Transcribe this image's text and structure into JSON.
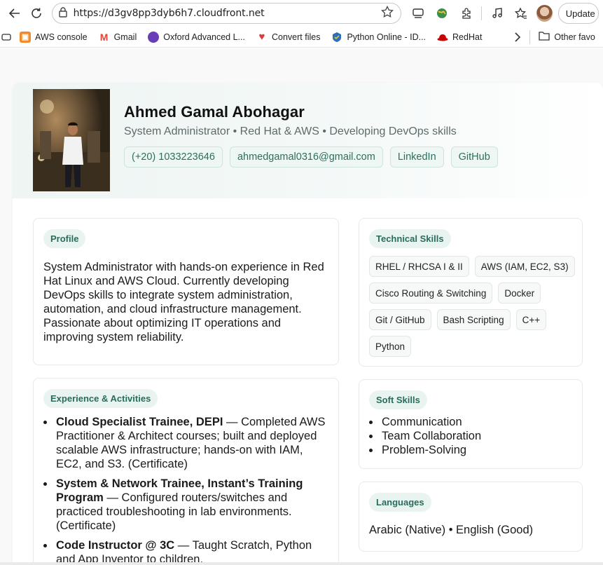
{
  "browser": {
    "url": "https://d3gv8pp3dyb6h7.cloudfront.net",
    "update_label": "Update",
    "bookmarks": [
      {
        "label": "AWS console",
        "icon": "aws-icon",
        "color": "#f08c2e"
      },
      {
        "label": "Gmail",
        "icon": "gmail-icon",
        "color": "#ea4335"
      },
      {
        "label": "Oxford Advanced L...",
        "icon": "oxford-icon",
        "color": "#6a3db8"
      },
      {
        "label": "Convert files",
        "icon": "convert-icon",
        "color": "#d93a3a"
      },
      {
        "label": "Python Online  - ID...",
        "icon": "python-icon",
        "color": "#2e6fb5"
      },
      {
        "label": "RedHat",
        "icon": "redhat-icon",
        "color": "#cc0000"
      }
    ],
    "other_favorites": "Other favo"
  },
  "profile": {
    "name": "Ahmed Gamal Abohagar",
    "tagline": "System Administrator • Red Hat & AWS • Developing DevOps skills",
    "contacts": [
      "(+20) 1033223646",
      "ahmedgamal0316@gmail.com",
      "LinkedIn",
      "GitHub"
    ]
  },
  "sections": {
    "profile_title": "Profile",
    "profile_text": "System Administrator with hands-on experience in Red Hat Linux and AWS Cloud. Currently developing DevOps skills to integrate system administration, automation, and cloud infrastructure management. Passionate about optimizing IT operations and improving system reliability.",
    "experience_title": "Experience & Activities",
    "experience": [
      {
        "title": "Cloud Specialist Trainee, DEPI",
        "desc": " — Completed AWS Practitioner & Architect courses; built and deployed scalable AWS infrastructure; hands-on with IAM, EC2, and S3. (Certificate)"
      },
      {
        "title": "System & Network Trainee, Instant’s Training Program",
        "desc": " — Configured routers/switches and practiced troubleshooting in lab environments. (Certificate)"
      },
      {
        "title": "Code Instructor @ 3C",
        "desc": " — Taught Scratch, Python and App Inventor to children."
      }
    ],
    "tech_title": "Technical Skills",
    "tech_skills": [
      "RHEL / RHCSA I & II",
      "AWS (IAM, EC2, S3)",
      "Cisco Routing & Switching",
      "Docker",
      "Git / GitHub",
      "Bash Scripting",
      "C++",
      "Python"
    ],
    "soft_title": "Soft Skills",
    "soft_skills": [
      "Communication",
      "Team Collaboration",
      "Problem-Solving"
    ],
    "lang_title": "Languages",
    "languages": "Arabic (Native) • English (Good)"
  },
  "colors": {
    "accent": "#2a6b5c",
    "tag_bg": "#e9f4f0"
  }
}
